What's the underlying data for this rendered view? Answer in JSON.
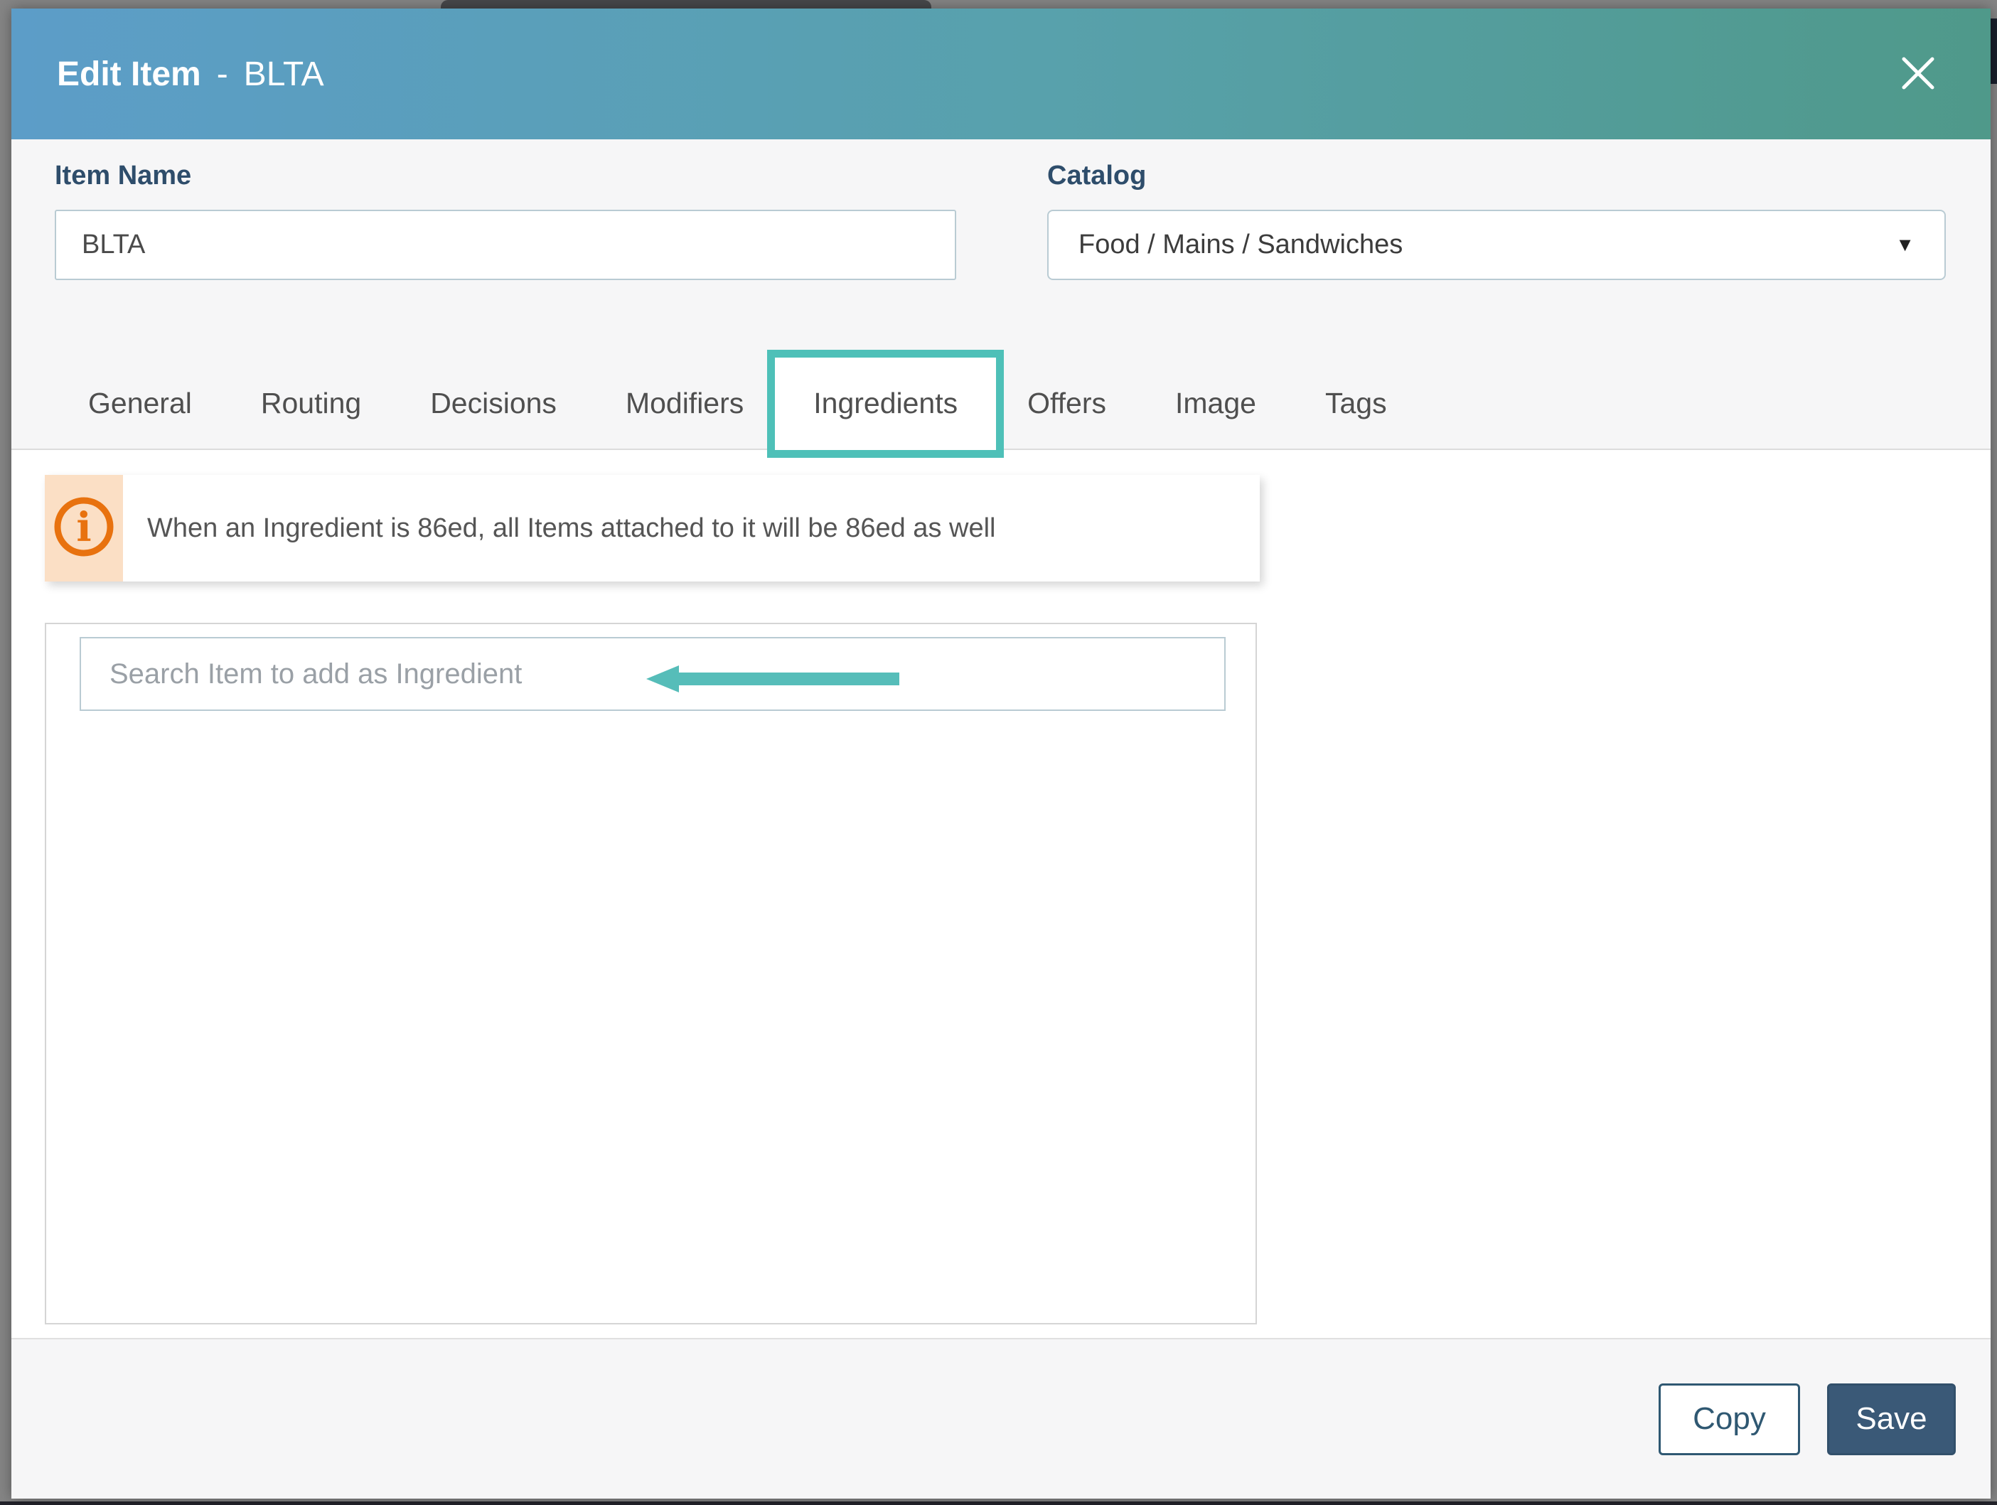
{
  "header": {
    "title": "Edit Item",
    "separator": "-",
    "item": "BLTA"
  },
  "form": {
    "item_name": {
      "label": "Item Name",
      "value": "BLTA"
    },
    "catalog": {
      "label": "Catalog",
      "value": "Food / Mains / Sandwiches",
      "caret": "▼"
    }
  },
  "tabs": {
    "items": [
      "General",
      "Routing",
      "Decisions",
      "Modifiers",
      "Ingredients",
      "Offers",
      "Image",
      "Tags"
    ],
    "active": "Ingredients"
  },
  "ingredients": {
    "banner": {
      "icon": "info-icon",
      "icon_glyph": "i",
      "text": "When an Ingredient is 86ed, all Items attached to it will be 86ed as well"
    },
    "search": {
      "placeholder": "Search Item to add as Ingredient"
    }
  },
  "footer": {
    "copy": "Copy",
    "save": "Save"
  },
  "colors": {
    "accent_teal": "#4ec0b8",
    "arrow_teal": "#56bdb9",
    "header_gradient_left": "#5c9dc8",
    "header_gradient_right": "#4f998a",
    "info_orange": "#e8720f",
    "info_strip": "#fbdfc5",
    "primary_button": "#3a5977",
    "label_blue": "#2e4d6b"
  }
}
